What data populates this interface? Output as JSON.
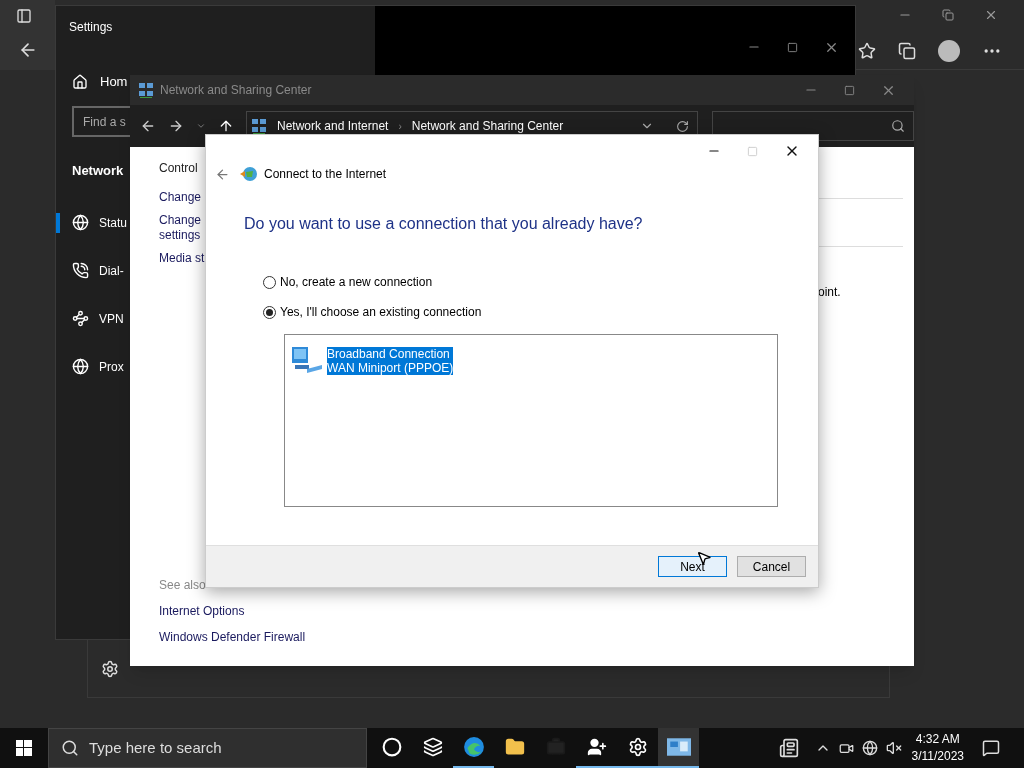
{
  "settings_window": {
    "title": "Settings",
    "home": "Hom",
    "search": {
      "placeholder": "Find a s"
    },
    "section": "Network",
    "items": [
      {
        "kind": "globe",
        "label": "Statu",
        "selected": true
      },
      {
        "kind": "phone",
        "label": "Dial-",
        "selected": false
      },
      {
        "kind": "vpn",
        "label": "VPN",
        "selected": false
      },
      {
        "kind": "globe",
        "label": "Prox",
        "selected": false
      }
    ]
  },
  "network_window": {
    "title": "Network and Sharing Center",
    "breadcrumb": [
      "Network and Internet",
      "Network and Sharing Center"
    ],
    "separator": "›",
    "links": [
      {
        "lines": [
          "Control"
        ]
      },
      {
        "lines": [
          "Change"
        ]
      },
      {
        "lines": [
          "Change",
          "settings"
        ]
      },
      {
        "lines": [
          "Media st"
        ]
      }
    ],
    "body_text": "oint.",
    "see_also": {
      "heading": "See also",
      "links": [
        "Internet Options",
        "Windows Defender Firewall"
      ]
    }
  },
  "dialog": {
    "title": "Connect to the Internet",
    "question": "Do you want to use a connection that you already have?",
    "options": [
      {
        "label": "No, create a new connection",
        "selected": false
      },
      {
        "label": "Yes, I'll choose an existing connection",
        "selected": true
      }
    ],
    "connections": [
      {
        "name": "Broadband Connection",
        "device": "WAN Miniport (PPPOE)",
        "selected": true
      }
    ],
    "buttons": [
      {
        "label": "Next",
        "default": true
      },
      {
        "label": "Cancel",
        "default": false
      }
    ]
  },
  "taskbar": {
    "search_placeholder": "Type here to search",
    "apps": [
      {
        "kind": "cortana",
        "running": false
      },
      {
        "kind": "taskview",
        "running": false
      },
      {
        "kind": "edge",
        "running": true
      },
      {
        "kind": "folder",
        "running": false
      },
      {
        "kind": "briefcase",
        "running": false
      },
      {
        "kind": "people",
        "running": true
      },
      {
        "kind": "settings",
        "running": true
      },
      {
        "kind": "control",
        "running": true
      }
    ],
    "time": "4:32 AM",
    "date": "3/11/2023"
  }
}
